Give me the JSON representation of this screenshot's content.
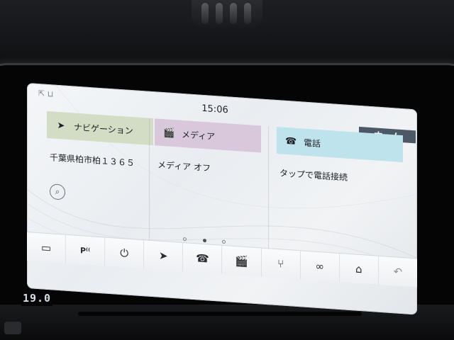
{
  "status_bar": {
    "time": "15:06"
  },
  "home_button": {
    "label": "ホーム"
  },
  "tiles": [
    {
      "id": "navigation",
      "icon": "navigation-arrow-icon",
      "icon_glyph": "➤",
      "title": "ナビゲーション",
      "subtitle": "千葉県柏市柏１３６５",
      "header_color": "#d3dcc4"
    },
    {
      "id": "media",
      "icon": "media-clapper-icon",
      "icon_glyph": "🎬",
      "title": "メディア",
      "subtitle": "メディア オフ",
      "header_color": "#d9c8dc"
    },
    {
      "id": "phone",
      "icon": "phone-icon",
      "icon_glyph": "☎",
      "title": "電話",
      "subtitle": "タップで電話接続",
      "header_color": "#bfe3ec"
    }
  ],
  "page_indicator": {
    "total": 3,
    "active_index": 1
  },
  "dock": [
    {
      "name": "camera-icon",
      "glyph": "▭"
    },
    {
      "name": "parking-sensor-icon",
      "glyph": "P⁽⁽"
    },
    {
      "name": "power-icon",
      "glyph": "⏻"
    },
    {
      "name": "navigation-arrow-icon",
      "glyph": "➤"
    },
    {
      "name": "phone-icon",
      "glyph": "☎"
    },
    {
      "name": "media-clapper-icon",
      "glyph": "🎬"
    },
    {
      "name": "seat-icon",
      "glyph": "⑂"
    },
    {
      "name": "apps-connect-icon",
      "glyph": "∞"
    },
    {
      "name": "home-icon",
      "glyph": "⌂"
    },
    {
      "name": "back-icon",
      "glyph": "↶"
    }
  ],
  "climate": {
    "temperature": "19.0"
  }
}
